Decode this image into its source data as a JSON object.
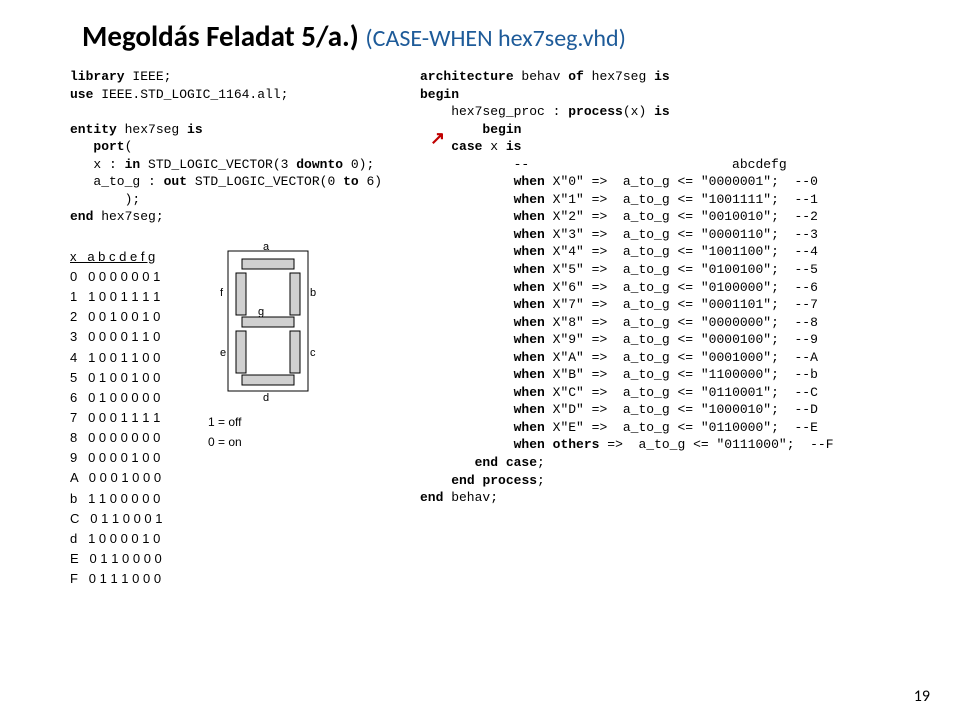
{
  "title_main": "Megoldás Feladat 5/a.) ",
  "title_paren": "(CASE-WHEN hex7seg.vhd)",
  "left_code": "library IEEE;\nuse IEEE.STD_LOGIC_1164.all;\n\nentity hex7seg is\n   port(\n   x : in STD_LOGIC_VECTOR(3 downto 0);\n   a_to_g : out STD_LOGIC_VECTOR(0 to 6)\n       );\nend hex7seg;",
  "truth_header": "x   a b c d e f g",
  "truth_rows": [
    "0   0 0 0 0 0 0 1",
    "1   1 0 0 1 1 1 1",
    "2   0 0 1 0 0 1 0",
    "3   0 0 0 0 1 1 0",
    "4   1 0 0 1 1 0 0",
    "5   0 1 0 0 1 0 0",
    "6   0 1 0 0 0 0 0",
    "7   0 0 0 1 1 1 1",
    "8   0 0 0 0 0 0 0",
    "9   0 0 0 0 1 0 0",
    "A   0 0 0 1 0 0 0",
    "b   1 1 0 0 0 0 0",
    "C   0 1 1 0 0 0 1",
    "d   1 0 0 0 0 1 0",
    "E   0 1 1 0 0 0 0",
    "F   0 1 1 1 0 0 0"
  ],
  "seg_labels": {
    "a": "a",
    "b": "b",
    "c": "c",
    "d": "d",
    "e": "e",
    "f": "f",
    "g": "g"
  },
  "legend_off": "1 = off",
  "legend_on": "0 = on",
  "right_code_head": "architecture behav of hex7seg is\nbegin\n    hex7seg_proc : process(x) is\n        begin\n    case x is\n            --                          abcdefg",
  "cases": [
    {
      "k": "X\"0\"",
      "v": "\"0000001\"",
      "c": "--0"
    },
    {
      "k": "X\"1\"",
      "v": "\"1001111\"",
      "c": "--1"
    },
    {
      "k": "X\"2\"",
      "v": "\"0010010\"",
      "c": "--2"
    },
    {
      "k": "X\"3\"",
      "v": "\"0000110\"",
      "c": "--3"
    },
    {
      "k": "X\"4\"",
      "v": "\"1001100\"",
      "c": "--4"
    },
    {
      "k": "X\"5\"",
      "v": "\"0100100\"",
      "c": "--5"
    },
    {
      "k": "X\"6\"",
      "v": "\"0100000\"",
      "c": "--6"
    },
    {
      "k": "X\"7\"",
      "v": "\"0001101\"",
      "c": "--7"
    },
    {
      "k": "X\"8\"",
      "v": "\"0000000\"",
      "c": "--8"
    },
    {
      "k": "X\"9\"",
      "v": "\"0000100\"",
      "c": "--9"
    },
    {
      "k": "X\"A\"",
      "v": "\"0001000\"",
      "c": "--A"
    },
    {
      "k": "X\"B\"",
      "v": "\"1100000\"",
      "c": "--b"
    },
    {
      "k": "X\"C\"",
      "v": "\"0110001\"",
      "c": "--C"
    },
    {
      "k": "X\"D\"",
      "v": "\"1000010\"",
      "c": "--D"
    },
    {
      "k": "X\"E\"",
      "v": "\"0110000\"",
      "c": "--E"
    }
  ],
  "case_others": {
    "v": "\"0111000\"",
    "c": "--F"
  },
  "right_code_tail": "       end case;\n    end process;\nend behav;",
  "page_number": "19"
}
